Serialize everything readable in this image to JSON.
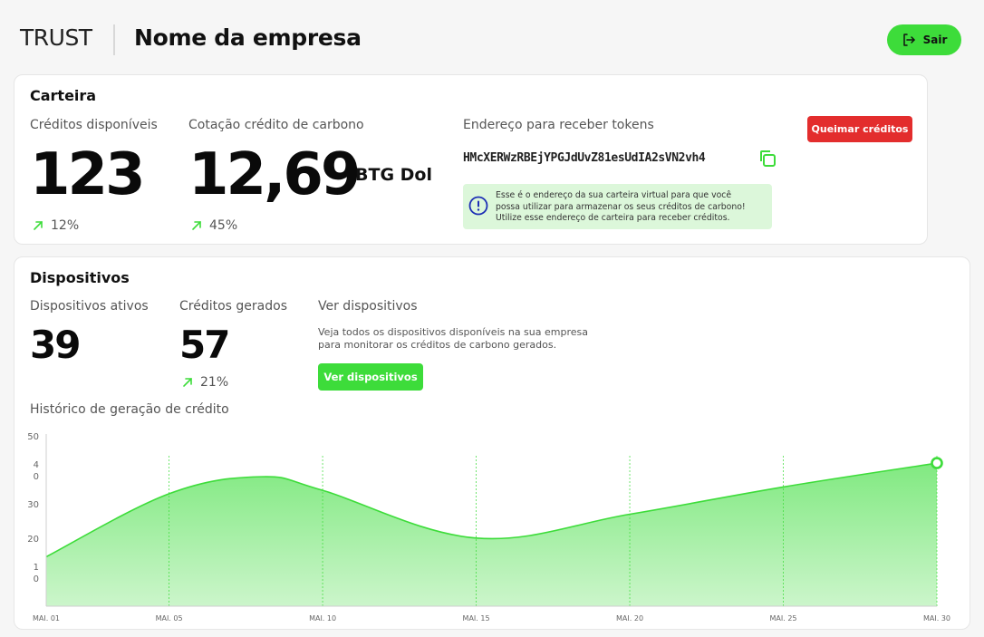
{
  "header": {
    "brand": "TRUST",
    "company_name": "Nome da empresa",
    "logout_label": "Sair"
  },
  "wallet": {
    "title": "Carteira",
    "available_credits": {
      "label": "Créditos disponíveis",
      "value": "123",
      "trend": "12%"
    },
    "carbon_quote": {
      "label": "Cotação crédito de carbono",
      "value": "12,69",
      "unit": "BTG Dol",
      "trend": "45%"
    },
    "address": {
      "label": "Endereço para receber tokens",
      "value": "HMcXERWzRBEjYPGJdUvZ81esUdIA2sVN2vh4",
      "info_lines": [
        "Esse é o endereço da sua carteira virtual para que você",
        "possa utilizar para armazenar os seus créditos de carbono!",
        "Utilize esse endereço de carteira para receber créditos."
      ]
    },
    "burn_button_label": "Queimar créditos"
  },
  "devices": {
    "title": "Dispositivos",
    "active": {
      "label": "Dispositivos ativos",
      "value": "39"
    },
    "generated": {
      "label": "Créditos gerados",
      "value": "57",
      "trend": "21%"
    },
    "view": {
      "label": "Ver dispositivos",
      "description_lines": [
        "Veja todos os dispositivos disponíveis na sua empresa",
        "para monitorar os créditos de carbono gerados."
      ],
      "button_label": "Ver dispositivos"
    },
    "history_label": "Histórico de geração de crédito"
  },
  "colors": {
    "accent_green": "#3ddc3a",
    "danger_red": "#e32d2d",
    "info_bg": "#dcf7da",
    "info_icon": "#1d2fb5"
  },
  "icons": {
    "logout": "logout-icon",
    "trend": "trend-up-icon",
    "copy": "copy-icon",
    "info": "info-icon"
  },
  "chart_data": {
    "type": "area",
    "y_tick_labels": [
      "50",
      "4\n0",
      "30",
      "20",
      "1\n0"
    ],
    "x_tick_labels": [
      "MAI. 01",
      "MAI. 05",
      "MAI. 10",
      "MAI. 15",
      "MAI. 20",
      "MAI. 25",
      "MAI. 30"
    ],
    "x": [
      1,
      5,
      8,
      10,
      15,
      20,
      25,
      30
    ],
    "values": [
      14.5,
      33,
      38,
      34,
      20,
      27,
      35,
      42
    ],
    "ylim": [
      0,
      50
    ],
    "grid": "vertical-dashed",
    "line_color": "#3ddc3a",
    "highlight_last_point": true
  }
}
